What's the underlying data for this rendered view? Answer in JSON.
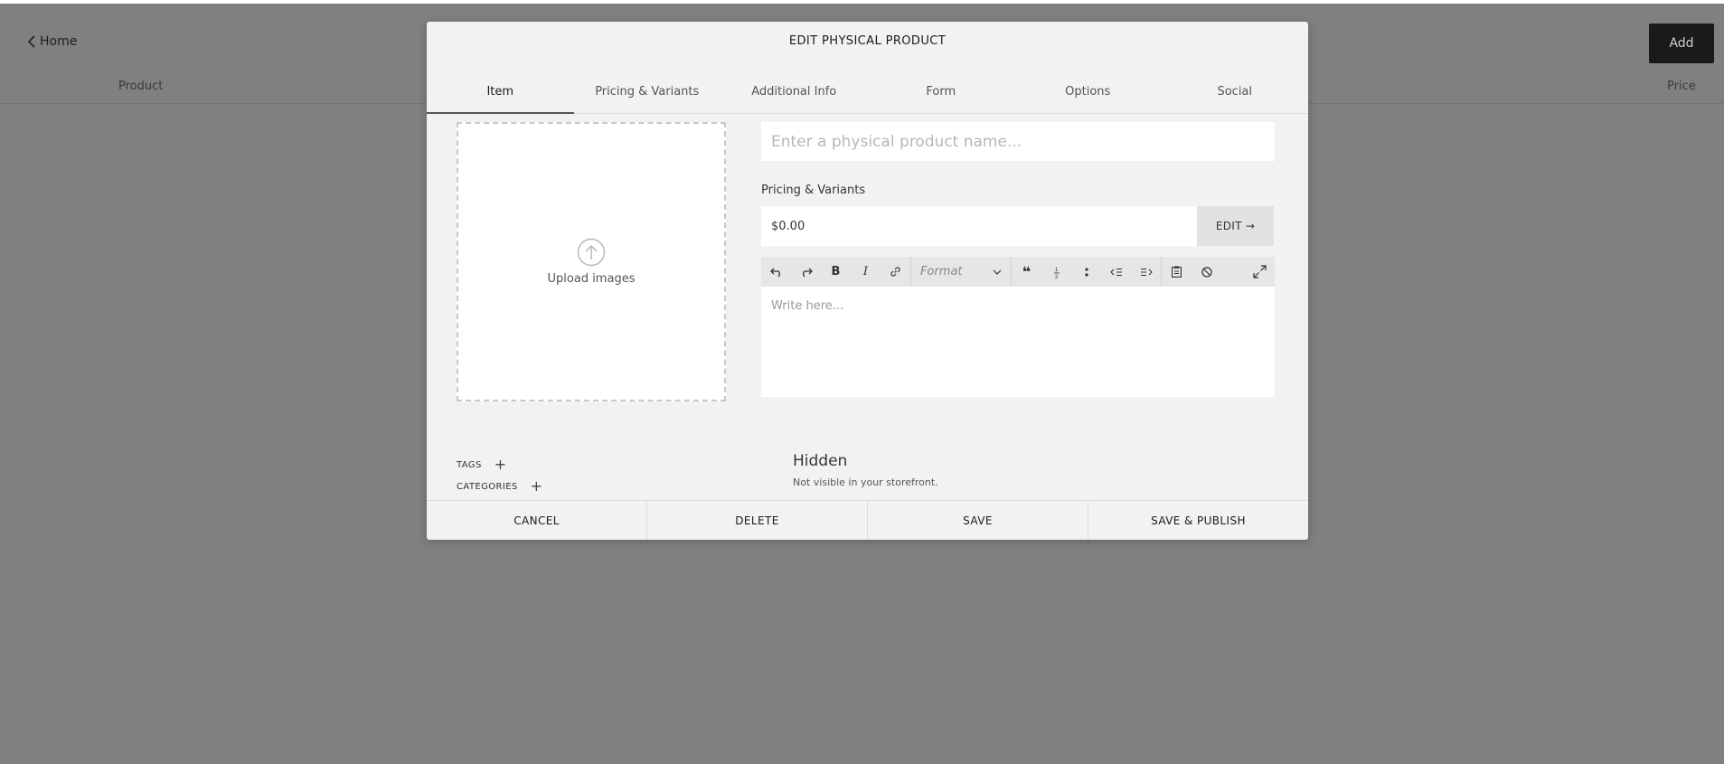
{
  "background": {
    "home_label": "Home",
    "add_label": "Add",
    "col_product": "Product",
    "col_price": "Price"
  },
  "modal": {
    "title": "EDIT PHYSICAL PRODUCT",
    "tabs": [
      {
        "label": "Item",
        "active": true
      },
      {
        "label": "Pricing & Variants",
        "active": false
      },
      {
        "label": "Additional Info",
        "active": false
      },
      {
        "label": "Form",
        "active": false
      },
      {
        "label": "Options",
        "active": false
      },
      {
        "label": "Social",
        "active": false
      }
    ],
    "upload_label": "Upload images",
    "name_placeholder": "Enter a physical product name...",
    "name_value": "",
    "pricing_label": "Pricing & Variants",
    "price_value": "$0.00",
    "edit_label": "EDIT →",
    "editor": {
      "format_label": "Format",
      "placeholder": "Write here..."
    },
    "tags_label": "TAGS",
    "categories_label": "CATEGORIES",
    "visibility_title": "Hidden",
    "visibility_sub": "Not visible in your storefront.",
    "footer": {
      "cancel": "CANCEL",
      "delete": "DELETE",
      "save": "SAVE",
      "save_publish": "SAVE & PUBLISH"
    }
  }
}
